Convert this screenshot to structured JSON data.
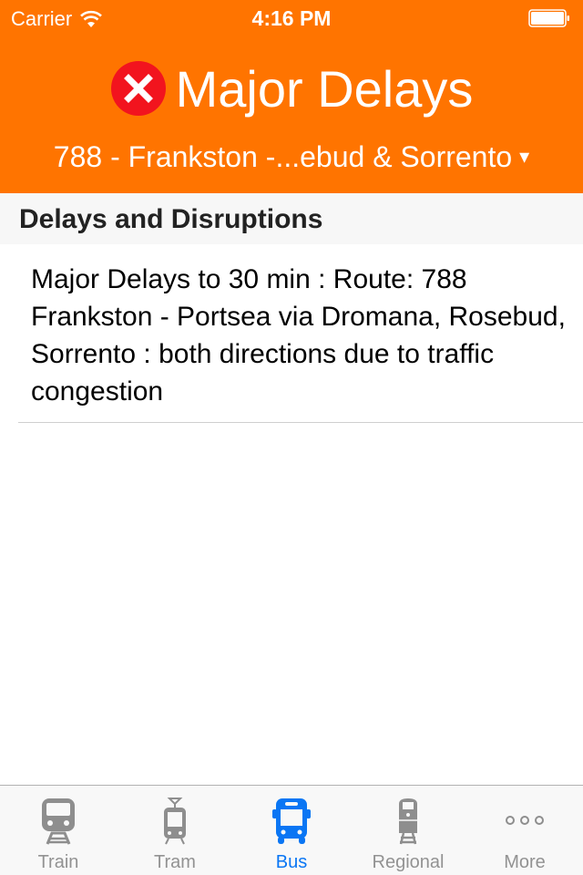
{
  "status_bar": {
    "carrier": "Carrier",
    "time": "4:16 PM",
    "wifi_icon": "wifi-icon",
    "battery_icon": "battery-icon"
  },
  "header": {
    "status_icon": "error-circle-x-icon",
    "title": "Major Delays",
    "route_selector": "788 - Frankston -...ebud & Sorrento",
    "route_caret": "▾",
    "colors": {
      "background": "#ff7400",
      "status_icon": "#f2141e"
    }
  },
  "section": {
    "title": "Delays and Disruptions"
  },
  "disruptions": [
    {
      "text": "Major Delays to 30 min : Route: 788 Frankston - Portsea via Dromana, Rosebud, Sorrento : both directions due to traffic congestion"
    }
  ],
  "tab_bar": {
    "active_color": "#0a76f4",
    "inactive_color": "#929292",
    "tabs": [
      {
        "label": "Train",
        "icon": "train-icon",
        "active": false
      },
      {
        "label": "Tram",
        "icon": "tram-icon",
        "active": false
      },
      {
        "label": "Bus",
        "icon": "bus-icon",
        "active": true
      },
      {
        "label": "Regional",
        "icon": "regional-train-icon",
        "active": false
      },
      {
        "label": "More",
        "icon": "more-icon",
        "active": false
      }
    ]
  }
}
